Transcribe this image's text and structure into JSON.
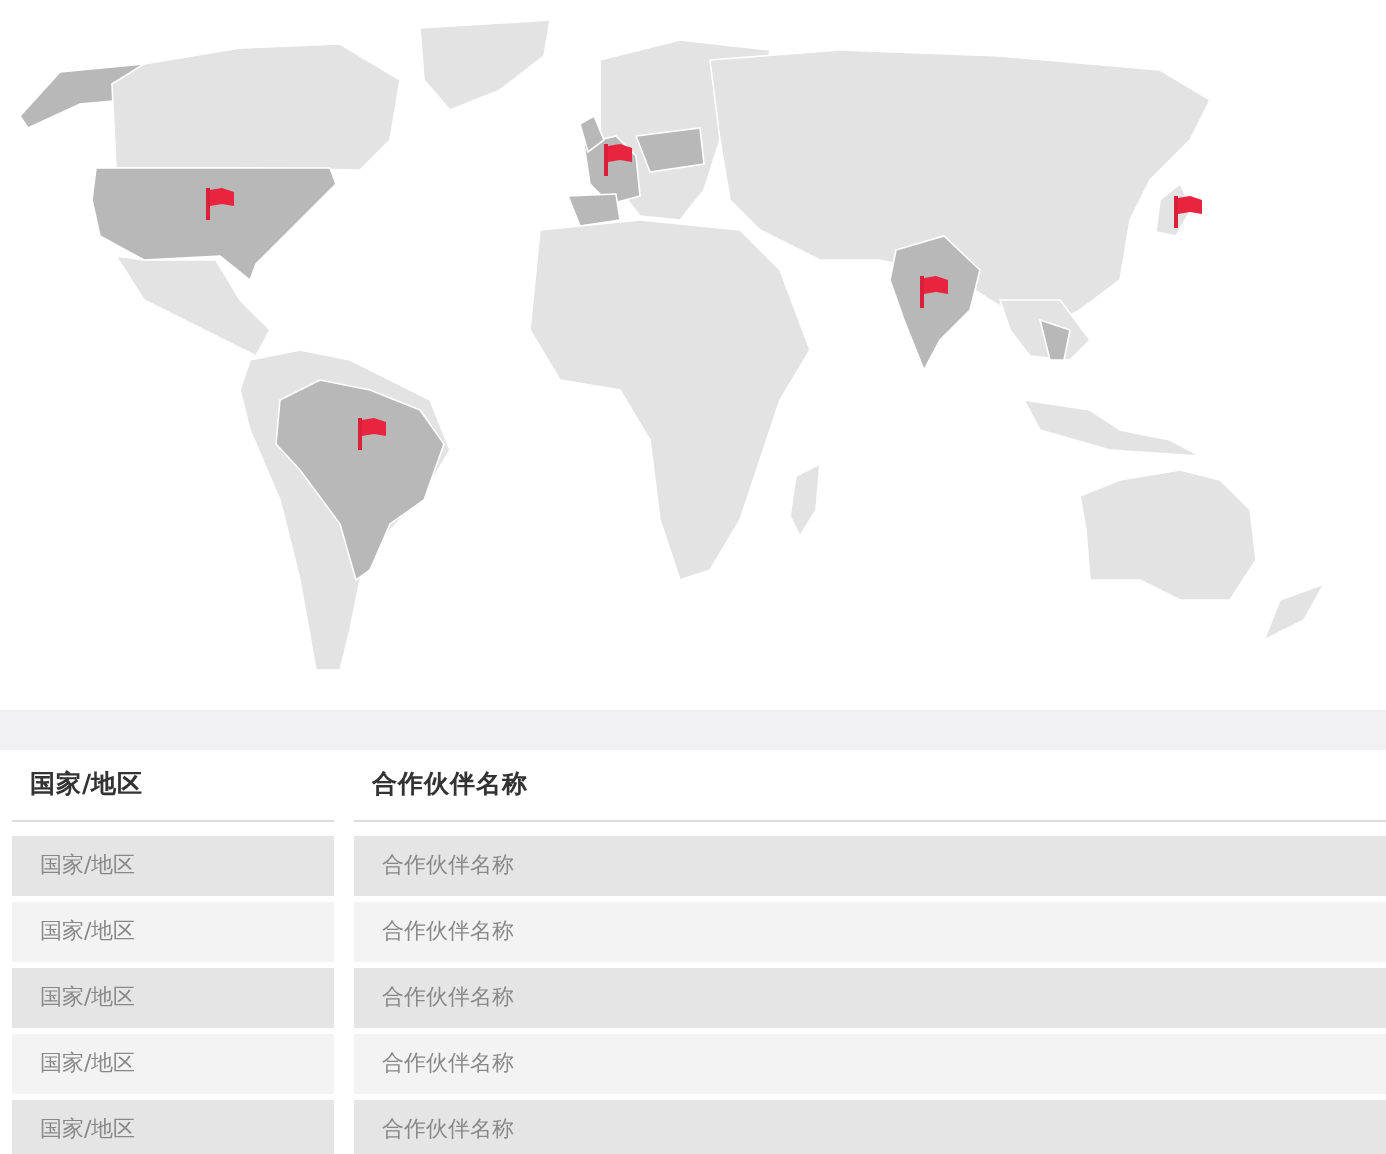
{
  "table": {
    "columns": [
      "国家/地区",
      "合作伙伴名称"
    ],
    "rows": [
      [
        "国家/地区",
        "合作伙伴名称"
      ],
      [
        "国家/地区",
        "合作伙伴名称"
      ],
      [
        "国家/地区",
        "合作伙伴名称"
      ],
      [
        "国家/地区",
        "合作伙伴名称"
      ],
      [
        "国家/地区",
        "合作伙伴名称"
      ]
    ]
  }
}
